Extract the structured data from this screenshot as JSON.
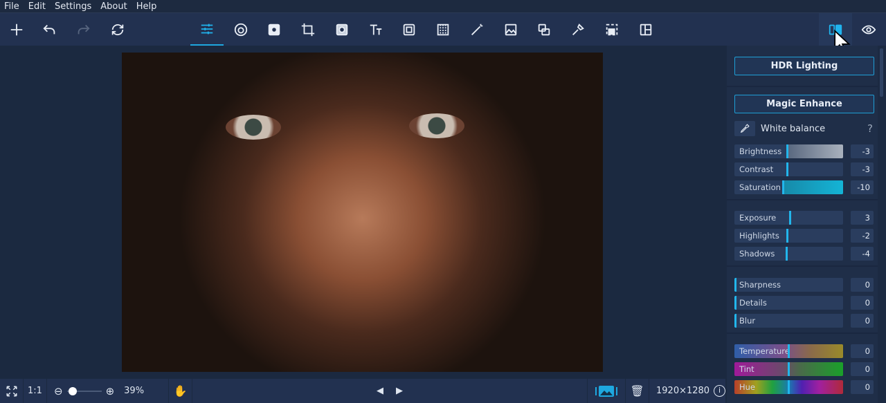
{
  "menu": [
    "File",
    "Edit",
    "Settings",
    "About",
    "Help"
  ],
  "toolbar": {
    "left": [
      "new-icon",
      "undo-icon",
      "redo-icon",
      "rotate-icon"
    ],
    "tools": [
      "adjust-icon",
      "retouch-icon",
      "effects-icon",
      "crop-icon",
      "filters-icon",
      "text-icon",
      "frame-icon",
      "background-icon",
      "magic-wand-icon",
      "image-icon",
      "overlay-icon",
      "pin-icon",
      "select-icon",
      "collage-icon"
    ],
    "right": [
      "compare-icon",
      "preview-eye-icon"
    ]
  },
  "panel": {
    "hdr_label": "HDR Lighting",
    "magic_label": "Magic Enhance",
    "white_balance_label": "White balance",
    "help": "?",
    "groups": [
      [
        {
          "label": "Brightness",
          "value": -3,
          "min": -100,
          "max": 100,
          "style": "gray"
        },
        {
          "label": "Contrast",
          "value": -3,
          "min": -100,
          "max": 100
        },
        {
          "label": "Saturation",
          "value": -10,
          "min": -100,
          "max": 100,
          "style": "cyan"
        }
      ],
      [
        {
          "label": "Exposure",
          "value": 3,
          "min": -100,
          "max": 100
        },
        {
          "label": "Highlights",
          "value": -2,
          "min": -100,
          "max": 100
        },
        {
          "label": "Shadows",
          "value": -4,
          "min": -100,
          "max": 100
        }
      ],
      [
        {
          "label": "Sharpness",
          "value": 0,
          "min": 0,
          "max": 100
        },
        {
          "label": "Details",
          "value": 0,
          "min": 0,
          "max": 100
        },
        {
          "label": "Blur",
          "value": 0,
          "min": 0,
          "max": 100
        }
      ],
      [
        {
          "label": "Temperature",
          "value": 0,
          "min": -100,
          "max": 100,
          "style": "temp"
        },
        {
          "label": "Tint",
          "value": 0,
          "min": -100,
          "max": 100,
          "style": "tint"
        },
        {
          "label": "Hue",
          "value": 0,
          "min": -100,
          "max": 100,
          "style": "hue"
        }
      ]
    ]
  },
  "bottom": {
    "fit": "fit-screen-icon",
    "actual": "1:1",
    "zoom_percent": "39%",
    "zoom_fraction": 0.05,
    "dimensions": "1920×1280"
  },
  "colors": {
    "accent": "#1ea8e0",
    "panel": "#1f2e48",
    "toolbar": "#223150"
  }
}
